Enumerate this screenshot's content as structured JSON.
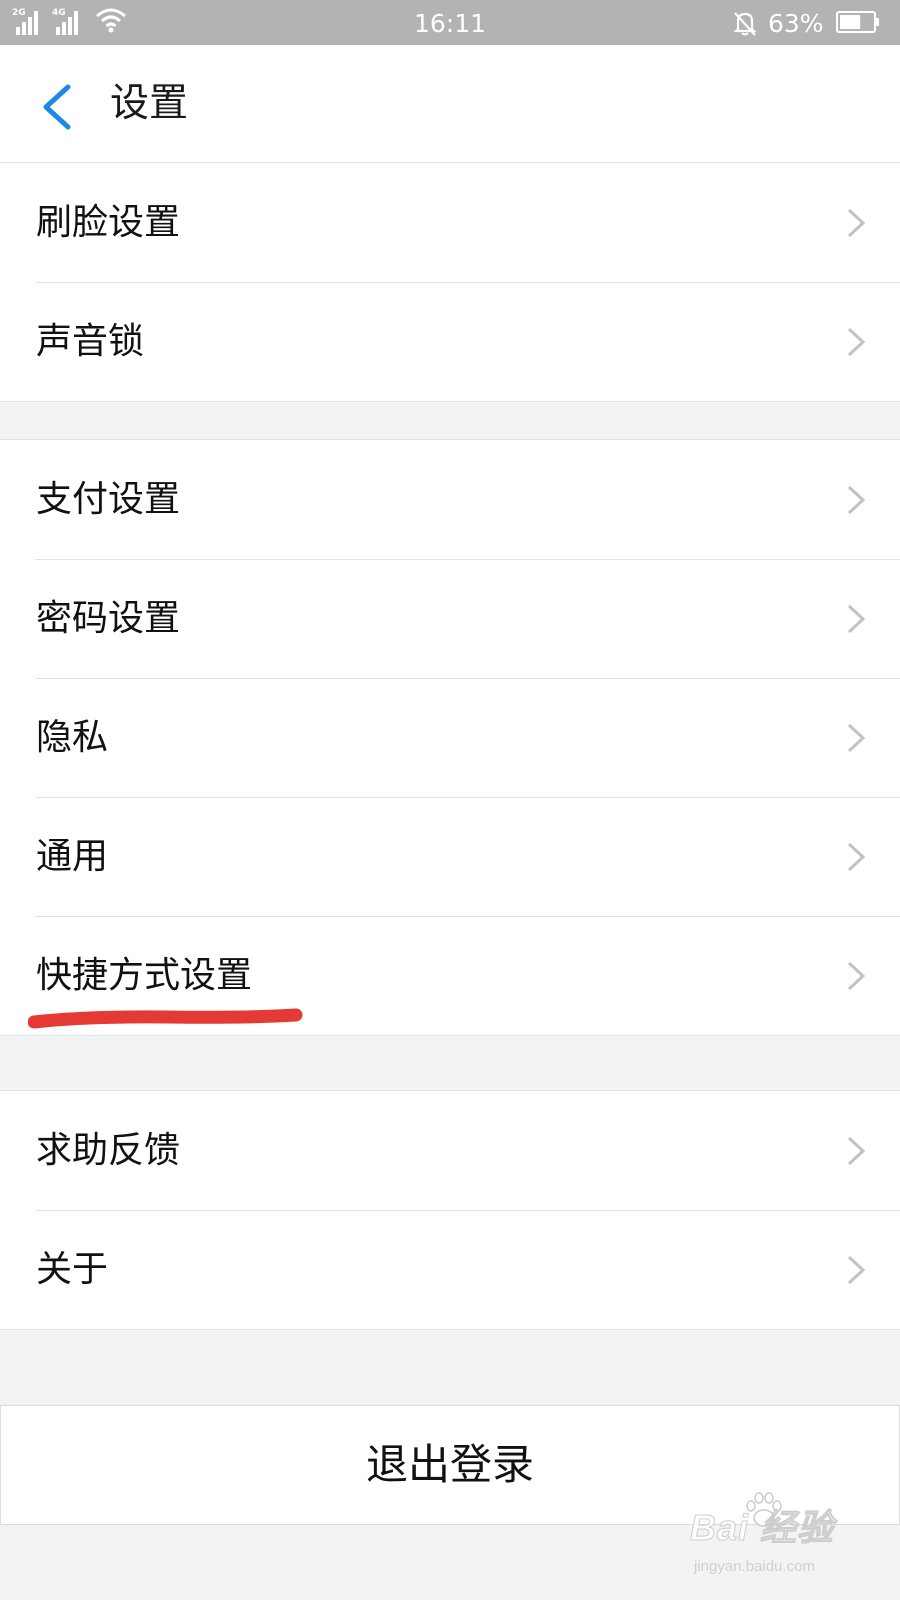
{
  "status_bar": {
    "network_1": "2G",
    "network_2": "4G",
    "time": "16:11",
    "battery_percent": "63%",
    "battery_level": 0.63,
    "icons": [
      "signal-icon",
      "wifi-icon",
      "bell-muted-icon",
      "battery-icon"
    ]
  },
  "header": {
    "title": "设置",
    "back_icon": "chevron-left-icon",
    "accent_color": "#1e88e5"
  },
  "groups": [
    {
      "items": [
        {
          "label": "刷脸设置"
        },
        {
          "label": "声音锁"
        }
      ]
    },
    {
      "items": [
        {
          "label": "支付设置"
        },
        {
          "label": "密码设置"
        },
        {
          "label": "隐私"
        },
        {
          "label": "通用"
        },
        {
          "label": "快捷方式设置"
        }
      ]
    },
    {
      "items": [
        {
          "label": "求助反馈"
        },
        {
          "label": "关于"
        }
      ]
    }
  ],
  "logout": {
    "label": "退出登录"
  },
  "annotation": {
    "color": "#e53935"
  },
  "watermark": {
    "main": "Bai 经验",
    "sub": "jingyan.baidu.com"
  }
}
